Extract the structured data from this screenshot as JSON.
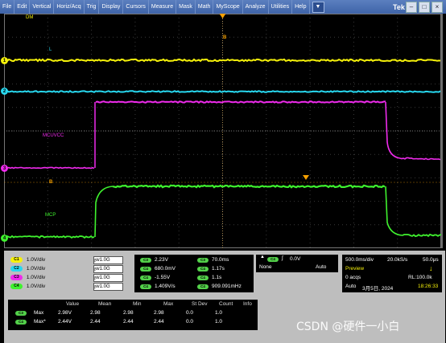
{
  "menu": {
    "items": [
      "File",
      "Edit",
      "Vertical",
      "Horiz/Acq",
      "Trig",
      "Display",
      "Cursors",
      "Measure",
      "Mask",
      "Math",
      "MyScope",
      "Analyze",
      "Utilities",
      "Help"
    ],
    "brand": "Tek"
  },
  "window_controls": [
    "–",
    "□",
    "×"
  ],
  "scope": {
    "labels": {
      "top_left": "DM",
      "ch1_label": "L",
      "ch3_label": "MCUVCC",
      "ch4_label": "MCP",
      "trigger_marker": "B",
      "ref_marker": "B"
    },
    "channel_markers": [
      "1",
      "2",
      "3",
      "4"
    ],
    "colors": {
      "ch1": "#f5f10a",
      "ch2": "#28d8ef",
      "ch3": "#ef2bec",
      "ch4": "#3ff22e",
      "trigger": "#f5a000"
    }
  },
  "channels": [
    {
      "id": "C1",
      "scale": "1.0V/div",
      "bw": "1.0G",
      "color": "#f5f10a"
    },
    {
      "id": "C2",
      "scale": "1.0V/div",
      "bw": "1.0G",
      "color": "#28d8ef"
    },
    {
      "id": "C3",
      "scale": "1.0V/div",
      "bw": "1.0G",
      "color": "#ef2bec"
    },
    {
      "id": "C4",
      "scale": "1.0V/div",
      "bw": "1.0G",
      "color": "#3ff22e"
    }
  ],
  "measurements": {
    "left": [
      {
        "badge": "C3",
        "value": "2.23V"
      },
      {
        "badge": "C4",
        "value": "680.0mV"
      },
      {
        "badge": "C4",
        "value": "-1.55V"
      },
      {
        "badge": "C4",
        "value": "1.409V/s"
      }
    ],
    "right": [
      {
        "badge": "C3",
        "value": "70.0ms"
      },
      {
        "badge": "C4",
        "value": "1.17s"
      },
      {
        "badge": "C4",
        "value": "1.1s"
      },
      {
        "badge": "C4",
        "value": "909.091mHz"
      }
    ]
  },
  "trigger": {
    "source": "C4",
    "slope": "∫",
    "level": "0.0V",
    "type": "None",
    "mode": "Auto"
  },
  "horizontal": {
    "timebase": "500.0ms/div",
    "sample_rate": "20.0kS/s",
    "resolution": "50.0μs",
    "state": "Preview",
    "acqs": "0 acqs",
    "record": "RL:100.0k",
    "run_mode": "Auto",
    "date": "3月5日, 2024",
    "time": "18:26:33"
  },
  "stats": {
    "headers": [
      "Value",
      "Mean",
      "Min",
      "Max",
      "St Dev",
      "Count",
      "Info"
    ],
    "rows": [
      {
        "badge": "C3",
        "name": "Max",
        "cells": [
          "2.98V",
          "2.98",
          "2.98",
          "2.98",
          "0.0",
          "1.0",
          ""
        ]
      },
      {
        "badge": "C4",
        "name": "Max*",
        "cells": [
          "2.44V",
          "2.44",
          "2.44",
          "2.44",
          "0.0",
          "1.0",
          ""
        ]
      }
    ]
  },
  "watermark": "CSDN @硬件一小白"
}
